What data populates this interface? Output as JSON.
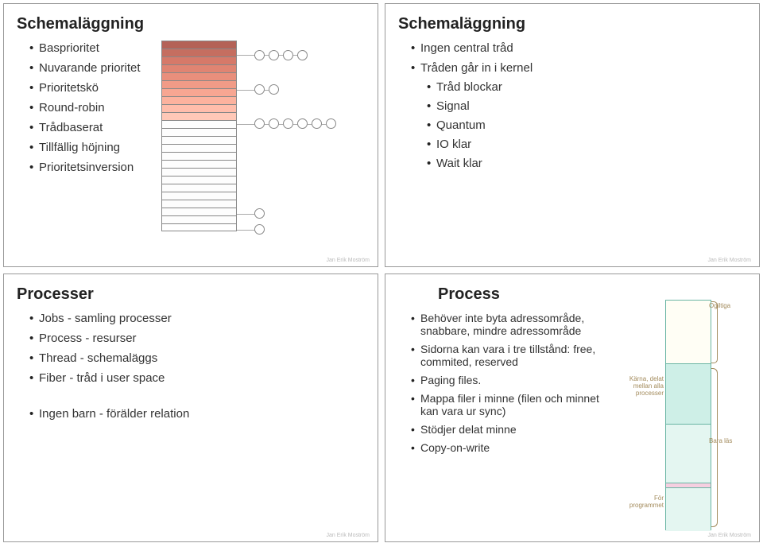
{
  "q1": {
    "title": "Schemaläggning",
    "items": [
      "Basprioritet",
      "Nuvarande prioritet",
      "Prioritetskö",
      "Round-robin",
      "Trådbaserat",
      "Tillfällig höjning",
      "Prioritetsinversion"
    ],
    "attribution": "Jan Erik Moström"
  },
  "q2": {
    "title": "Schemaläggning",
    "items": [
      "Ingen central tråd",
      "Tråden går in i kernel"
    ],
    "nested": [
      "Tråd blockar",
      "Signal",
      "Quantum",
      "IO klar",
      "Wait klar"
    ],
    "attribution": "Jan Erik Moström"
  },
  "q3": {
    "title": "Processer",
    "items": [
      "Jobs - samling processer",
      "Process - resurser",
      "Thread - schemaläggs",
      "Fiber - tråd i user space"
    ],
    "extra": "Ingen barn - förälder relation",
    "attribution": "Jan Erik Moström"
  },
  "q4": {
    "title": "Process",
    "items": [
      "Behöver inte byta adressområde, snabbare, mindre adressområde",
      "Sidorna kan vara i tre tillstånd: free, commited, reserved",
      "Paging files.",
      "Mappa filer i minne (filen och minnet kan vara ur sync)",
      "Stödjer delat minne",
      "Copy-on-write"
    ],
    "mem_labels": {
      "invalid": "Ogiltiga",
      "kernel": "Kärna, delat mellan alla processer",
      "readonly": "Bara läs",
      "program": "För programmet"
    },
    "attribution": "Jan Erik Moström"
  }
}
